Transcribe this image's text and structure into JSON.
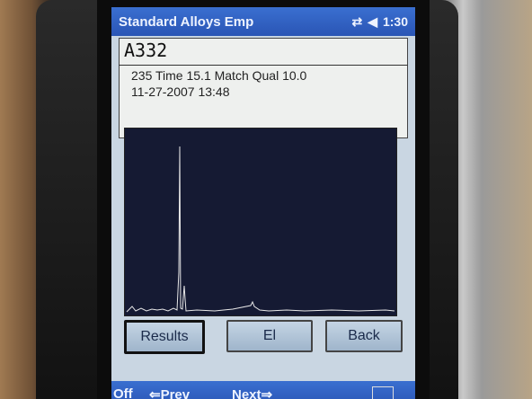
{
  "window": {
    "title": "Standard Alloys Emp",
    "time": "1:30"
  },
  "status_icons": [
    "connectivity-icon",
    "volume-icon"
  ],
  "result": {
    "alloy": "A332",
    "line1": "235 Time   15.1 Match Qual 10.0",
    "line2": "11-27-2007 13:48"
  },
  "buttons": {
    "results": "Results",
    "el": "El",
    "back": "Back"
  },
  "softkeys": {
    "off": "Off",
    "prev": "Prev",
    "next": "Next"
  },
  "colors": {
    "titlebar": "#2f5fc4",
    "plot_bg": "#151a33",
    "trace": "#e8e8e8"
  }
}
